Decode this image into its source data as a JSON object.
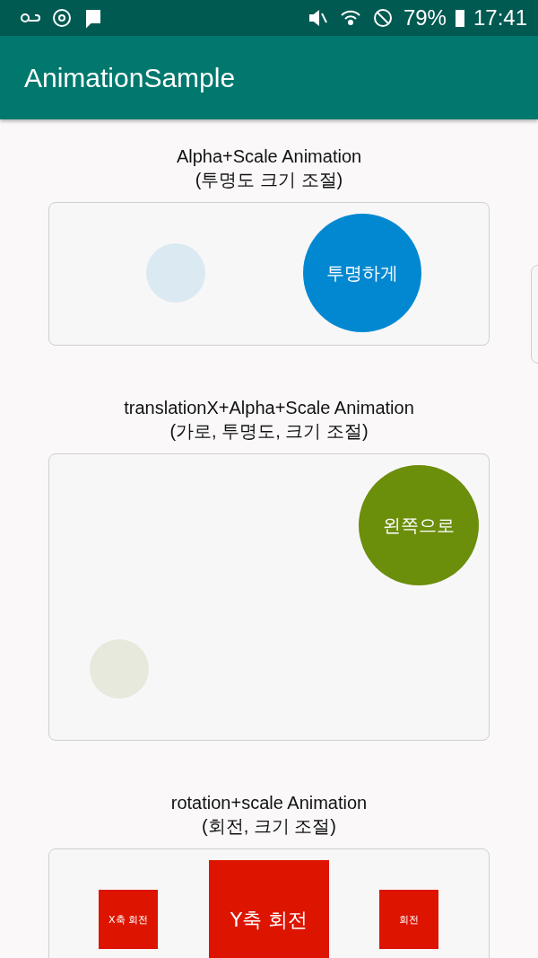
{
  "status_bar": {
    "battery": "79%",
    "time": "17:41"
  },
  "app_bar": {
    "title": "AnimationSample"
  },
  "sections": [
    {
      "title": "Alpha+Scale Animation",
      "subtitle": "(투명도 크기 조절)",
      "items": [
        {
          "kind": "circle",
          "color": "#dbeaf2"
        },
        {
          "kind": "circle",
          "color": "#0288d1",
          "label": "투명하게"
        }
      ]
    },
    {
      "title": "translationX+Alpha+Scale Animation",
      "subtitle": "(가로, 투명도, 크기 조절)",
      "items": [
        {
          "kind": "circle",
          "color": "#6b8e0b",
          "label": "왼쪽으로"
        },
        {
          "kind": "circle",
          "color": "#e6e9dc"
        }
      ]
    },
    {
      "title": "rotation+scale Animation",
      "subtitle": "(회전, 크기 조절)",
      "items": [
        {
          "kind": "square",
          "color": "#dd1500",
          "label": "X축 회전"
        },
        {
          "kind": "square",
          "color": "#dd1500",
          "label": "Y축 회전"
        },
        {
          "kind": "square",
          "color": "#dd1500",
          "label": "회전"
        }
      ]
    }
  ]
}
